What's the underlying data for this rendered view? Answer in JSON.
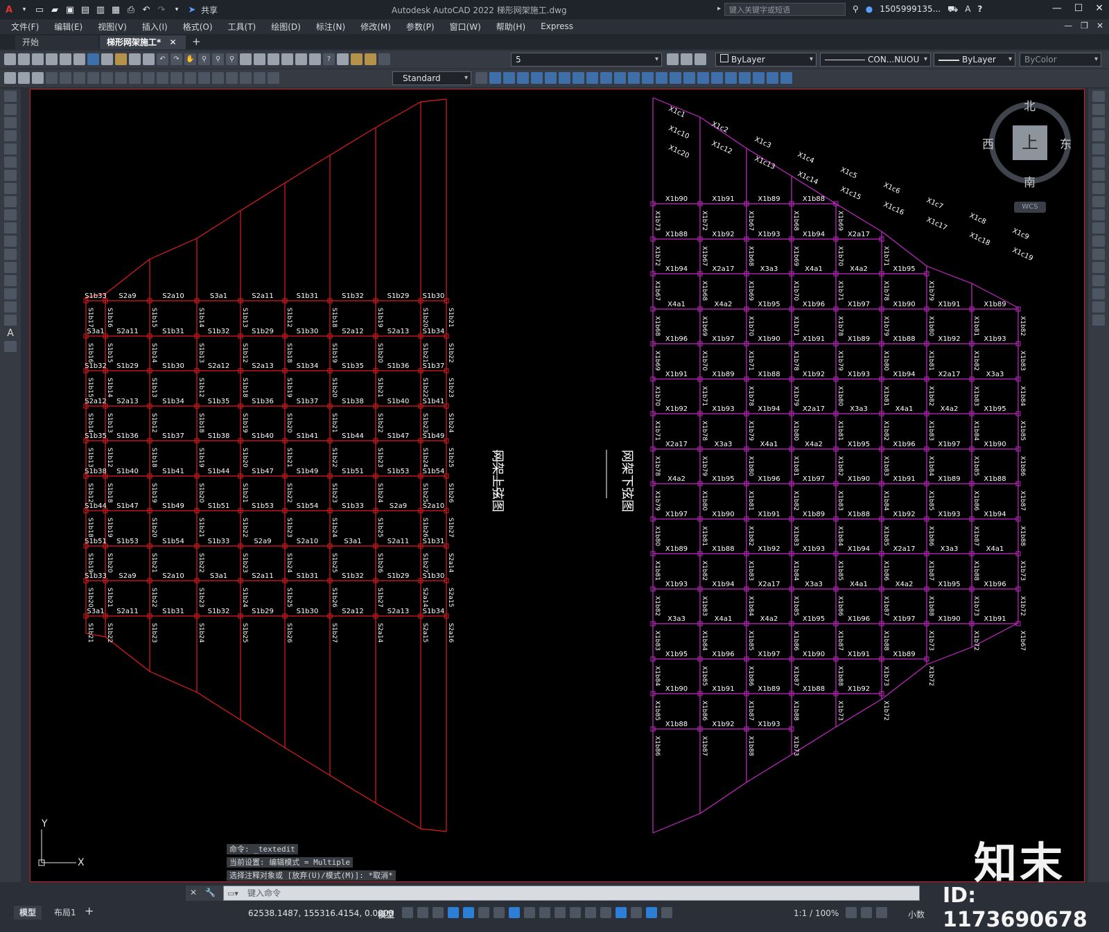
{
  "title_bar": {
    "app_title": "Autodesk AutoCAD 2022    梯形网架施工.dwg",
    "share_label": "共享",
    "search_placeholder": "键入关键字或短语",
    "user_name": "1505999135...",
    "quick_access_icons": [
      "autocad-logo-icon",
      "new-icon",
      "open-icon",
      "save-icon",
      "saveas-icon",
      "publish-icon",
      "plot-icon",
      "undo-icon",
      "redo-icon"
    ]
  },
  "menu": {
    "items": [
      "文件(F)",
      "编辑(E)",
      "视图(V)",
      "插入(I)",
      "格式(O)",
      "工具(T)",
      "绘图(D)",
      "标注(N)",
      "修改(M)",
      "参数(P)",
      "窗口(W)",
      "帮助(H)",
      "Express"
    ]
  },
  "doc_tabs": [
    {
      "label": "开始",
      "active": false
    },
    {
      "label": "梯形网架施工*",
      "active": true
    }
  ],
  "toolbar_props": {
    "layer_value": "5",
    "color_value": "ByLayer",
    "linetype_value": "CON...NUOU",
    "lineweight_value": "ByLayer",
    "plotstyle_value": "ByColor",
    "textstyle_value": "Standard"
  },
  "viewcube": {
    "north": "北",
    "south": "南",
    "east": "东",
    "west": "西",
    "face": "上",
    "wcs_label": "WCS"
  },
  "drawing": {
    "upper_title": "网架上弦图",
    "lower_title": "网架下弦图",
    "upper_labels": {
      "rows": [
        "S1b33",
        "S2a9",
        "S2a10",
        "S3a1",
        "S2a11",
        "S1b31",
        "S1b32",
        "S1b29",
        "S1b30",
        "S2a12",
        "S2a13",
        "S1b34",
        "S1b35",
        "S1b36",
        "S1b37",
        "S1b38",
        "S1b40",
        "S1b41",
        "S1b44",
        "S1b47",
        "S1b49",
        "S1b51",
        "S1b53",
        "S1b54"
      ],
      "cols": [
        "S1b17",
        "S1b16",
        "S1b15",
        "S1b14",
        "S1b13",
        "S1b12",
        "S1b18",
        "S1b19",
        "S1b20",
        "S1b21",
        "S1b22",
        "S1b23",
        "S1b24",
        "S1b25",
        "S1b26",
        "S1b27",
        "S2a14",
        "S2a15",
        "S2a16"
      ]
    },
    "lower_labels": {
      "rows": [
        "X1b90",
        "X1b91",
        "X1b89",
        "X1b88",
        "X1b92",
        "X1b93",
        "X1b94",
        "X2a17",
        "X3a3",
        "X4a1",
        "X4a2",
        "X1b95",
        "X1b96",
        "X1b97"
      ],
      "cols": [
        "X1b73",
        "X1b72",
        "X1b67",
        "X1b68",
        "X1b69",
        "X1b70",
        "X1b71",
        "X1b78",
        "X1b79",
        "X1b80",
        "X1b81",
        "X1b82",
        "X1b83",
        "X1b84",
        "X1b85",
        "X1b86",
        "X1b87",
        "X1b88"
      ],
      "diagonals": [
        "X1c1",
        "X1c2",
        "X1c3",
        "X1c4",
        "X1c5",
        "X1c6",
        "X1c7",
        "X1c8",
        "X1c9",
        "X1c10",
        "X1c12",
        "X1c13",
        "X1c14",
        "X1c15",
        "X1c16",
        "X1c17",
        "X1c18",
        "X1c19",
        "X1c20"
      ]
    },
    "ucs": {
      "x": "X",
      "y": "Y"
    }
  },
  "command": {
    "history": [
      "命令: _textedit",
      "当前设置: 编辑模式 = Multiple",
      "选择注释对象或 [放弃(U)/模式(M)]: *取消*"
    ],
    "input_placeholder": "键入命令"
  },
  "status": {
    "layout_tabs": [
      "模型",
      "布局1"
    ],
    "coordinates": "62538.1487, 155316.4154, 0.0000",
    "space": "模型",
    "annotation_scale": "1:1 / 100%",
    "units": "小数"
  },
  "watermark": {
    "brand": "知末",
    "id_text": "ID: 1173690678"
  },
  "colors": {
    "upper_frame": "#e11b22",
    "lower_frame": "#c728c8",
    "canvas_bg": "#000000",
    "label": "#ffffff"
  }
}
